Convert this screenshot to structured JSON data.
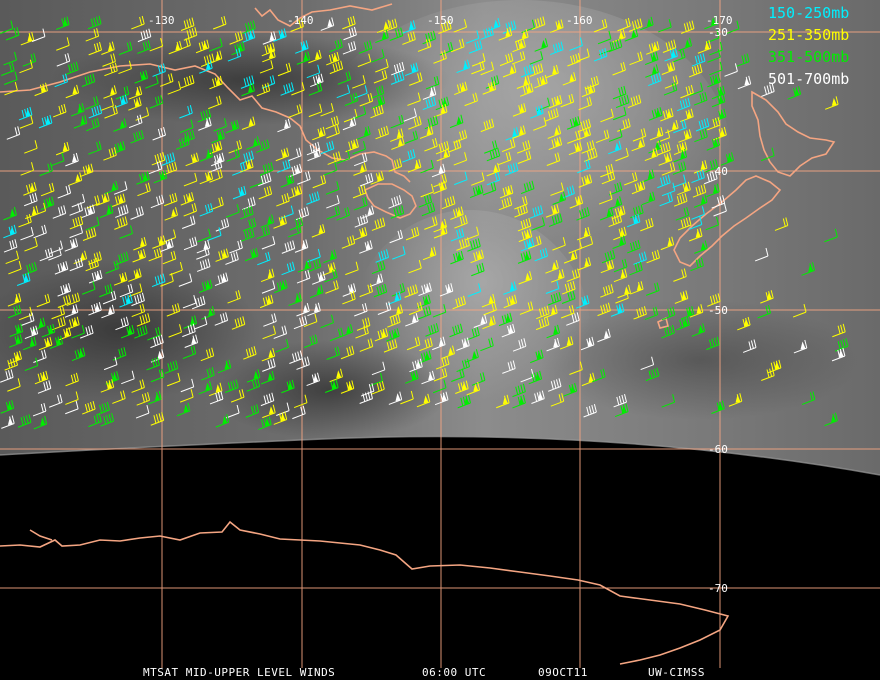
{
  "map": {
    "longitude_labels": [
      "-130",
      "-140",
      "-150",
      "-160",
      "-170"
    ],
    "latitude_labels": [
      "-30",
      "-40",
      "-50",
      "-60",
      "-70"
    ]
  },
  "legend": {
    "items": [
      {
        "label": "150-250mb",
        "color": "#00f0ff"
      },
      {
        "label": "251-350mb",
        "color": "#ffff00"
      },
      {
        "label": "351-500mb",
        "color": "#00ee00"
      },
      {
        "label": "501-700mb",
        "color": "#ffffff"
      }
    ]
  },
  "footer": {
    "product": "MTSAT MID-UPPER LEVEL WINDS",
    "time": "06:00 UTC",
    "date": "09OCT11",
    "source": "UW-CIMSS"
  },
  "colors": {
    "gridline": "#f4a582",
    "coastline": "#f4a582",
    "space": "#000000"
  }
}
